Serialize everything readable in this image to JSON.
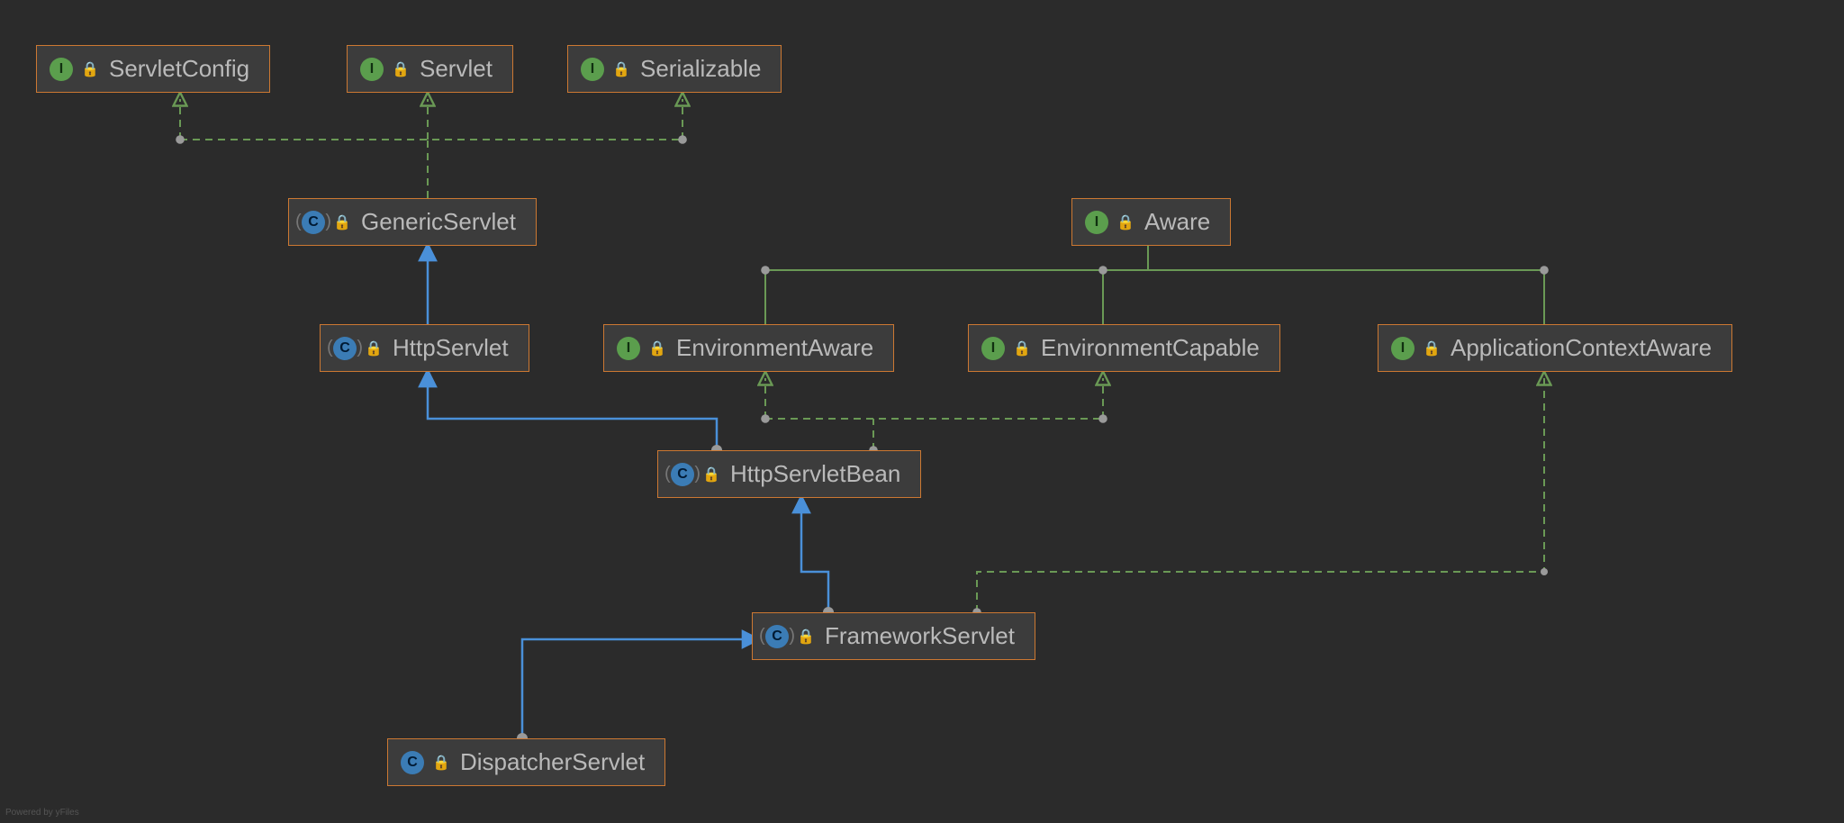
{
  "nodes": {
    "servletConfig": {
      "kind": "interface",
      "label": "ServletConfig"
    },
    "servlet": {
      "kind": "interface",
      "label": "Servlet"
    },
    "serializable": {
      "kind": "interface",
      "label": "Serializable"
    },
    "genericServlet": {
      "kind": "abstract-class",
      "label": "GenericServlet"
    },
    "aware": {
      "kind": "interface",
      "label": "Aware"
    },
    "httpServlet": {
      "kind": "abstract-class",
      "label": "HttpServlet"
    },
    "environmentAware": {
      "kind": "interface",
      "label": "EnvironmentAware"
    },
    "environmentCapable": {
      "kind": "interface",
      "label": "EnvironmentCapable"
    },
    "applicationContextAware": {
      "kind": "interface",
      "label": "ApplicationContextAware"
    },
    "httpServletBean": {
      "kind": "abstract-class",
      "label": "HttpServletBean"
    },
    "frameworkServlet": {
      "kind": "abstract-class",
      "label": "FrameworkServlet"
    },
    "dispatcherServlet": {
      "kind": "class",
      "label": "DispatcherServlet"
    }
  },
  "edges": [
    {
      "from": "genericServlet",
      "to": "servletConfig",
      "rel": "implements"
    },
    {
      "from": "genericServlet",
      "to": "servlet",
      "rel": "implements"
    },
    {
      "from": "genericServlet",
      "to": "serializable",
      "rel": "implements"
    },
    {
      "from": "httpServlet",
      "to": "genericServlet",
      "rel": "extends"
    },
    {
      "from": "environmentAware",
      "to": "aware",
      "rel": "extends-interface"
    },
    {
      "from": "environmentCapable",
      "to": "aware",
      "rel": "extends-interface"
    },
    {
      "from": "applicationContextAware",
      "to": "aware",
      "rel": "extends-interface"
    },
    {
      "from": "httpServletBean",
      "to": "httpServlet",
      "rel": "extends"
    },
    {
      "from": "httpServletBean",
      "to": "environmentAware",
      "rel": "implements"
    },
    {
      "from": "httpServletBean",
      "to": "environmentCapable",
      "rel": "implements"
    },
    {
      "from": "frameworkServlet",
      "to": "httpServletBean",
      "rel": "extends"
    },
    {
      "from": "frameworkServlet",
      "to": "applicationContextAware",
      "rel": "implements"
    },
    {
      "from": "dispatcherServlet",
      "to": "frameworkServlet",
      "rel": "extends"
    }
  ],
  "colors": {
    "border": "#cc7832",
    "extends": "#4a90d9",
    "implements": "#6a9955",
    "background": "#2b2b2b",
    "node_bg": "#3c3c3c"
  },
  "powered_by": "Powered by yFiles"
}
